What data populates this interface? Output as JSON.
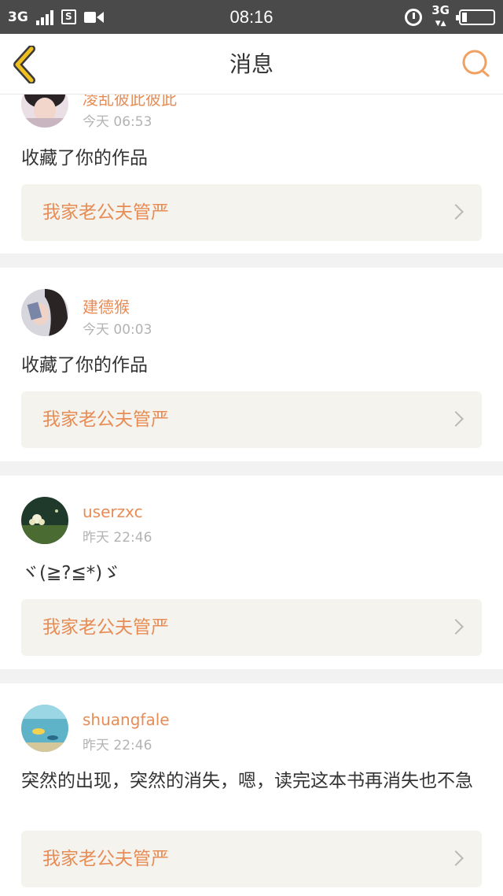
{
  "status_bar": {
    "network_left": "3G",
    "sim_label": "S",
    "time": "08:16",
    "network_right": "3G"
  },
  "nav": {
    "title": "消息",
    "back_icon": "chevron-left-icon",
    "search_icon": "search-icon",
    "accent": "#e88c55",
    "back_color": "#f0c020"
  },
  "messages": [
    {
      "username": "凌乱彼此彼此",
      "time": "今天 06:53",
      "text": "收藏了你的作品",
      "work_title": "我家老公夫管严"
    },
    {
      "username": "建德猴",
      "time": "今天 00:03",
      "text": "收藏了你的作品",
      "work_title": "我家老公夫管严"
    },
    {
      "username": "userzxc",
      "time": "昨天 22:46",
      "text": "ヾ(≧?≦*)ゞ",
      "work_title": "我家老公夫管严"
    },
    {
      "username": "shuangfale",
      "time": "昨天 22:46",
      "text": "突然的出现，突然的消失，嗯，读完这本书再消失也不急",
      "work_title": "我家老公夫管严"
    }
  ]
}
